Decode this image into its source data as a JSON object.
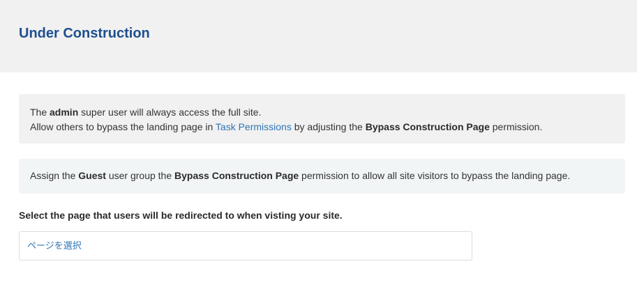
{
  "header": {
    "title": "Under Construction"
  },
  "notice_admin": {
    "line1_prefix": "The ",
    "line1_bold": "admin",
    "line1_suffix": " super user will always access the full site.",
    "line2_prefix": "Allow others to bypass the landing page in ",
    "line2_link": "Task Permissions",
    "line2_middle": " by adjusting the ",
    "line2_bold": "Bypass Construction Page",
    "line2_suffix": " permission."
  },
  "notice_guest": {
    "prefix": "Assign the ",
    "bold1": "Guest",
    "middle": " user group the ",
    "bold2": "Bypass Construction Page",
    "suffix": " permission to allow all site visitors to bypass the landing page."
  },
  "redirect": {
    "label": "Select the page that users will be redirected to when visting your site.",
    "select_text": "ページを選択"
  }
}
